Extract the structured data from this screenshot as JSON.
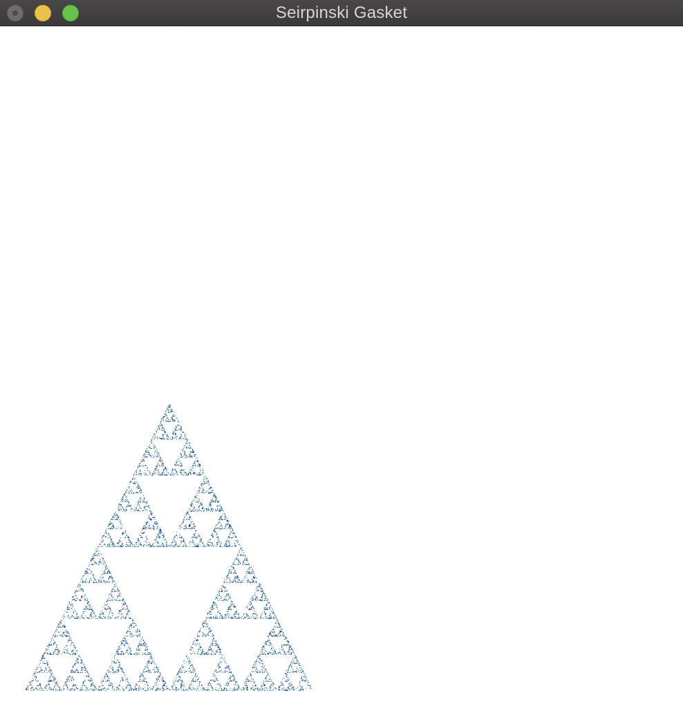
{
  "window": {
    "title": "Seirpinski Gasket"
  },
  "colors": {
    "titlebar": "#3f3c3d",
    "title_text": "#d6d4d5",
    "close": "#6f6c6d",
    "minimize": "#e8c24a",
    "maximize": "#69c24a",
    "canvas_bg": "#ffffff",
    "point_primary": "#0b1f8a",
    "point_secondary": "#1e9a4a",
    "point_tertiary": "#0c5c7a"
  }
}
